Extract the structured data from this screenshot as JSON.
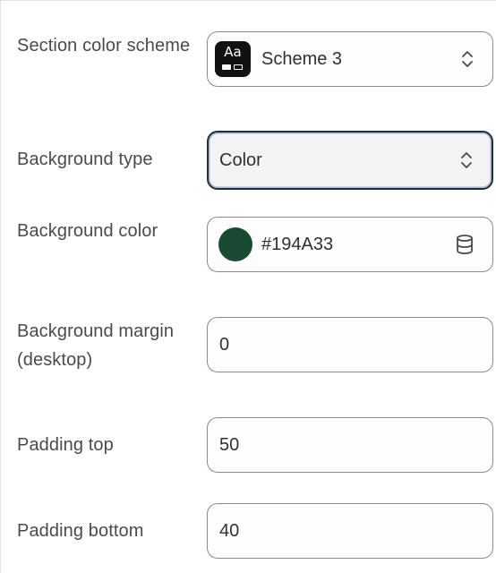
{
  "settings": {
    "section_color_scheme": {
      "label": "Section color scheme",
      "badge_text": "Aa",
      "value": "Scheme 3",
      "icon": "chevron-updown-icon"
    },
    "background_type": {
      "label": "Background type",
      "value": "Color",
      "icon": "chevron-updown-icon"
    },
    "background_color": {
      "label": "Background color",
      "value": "#194A33",
      "swatch_color": "#194A33",
      "icon": "database-icon"
    },
    "background_margin_desktop": {
      "label": "Background margin (desktop)",
      "value": "0"
    },
    "padding_top": {
      "label": "Padding top",
      "value": "50"
    },
    "padding_bottom": {
      "label": "Padding bottom",
      "value": "40"
    }
  },
  "colors": {
    "focus_border": "#1f2d47",
    "input_border": "#8a8a8a",
    "label_text": "#4a4a4a"
  }
}
